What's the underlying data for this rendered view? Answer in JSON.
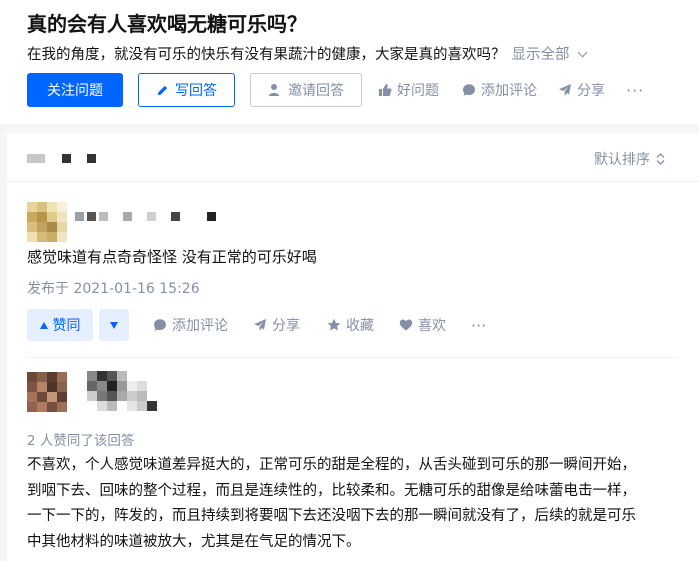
{
  "question": {
    "title": "真的会有人喜欢喝无糖可乐吗？",
    "description": "在我的角度，就没有可乐的快乐有没有果蔬汁的健康，大家是真的喜欢吗？",
    "show_all": "显示全部"
  },
  "actions": {
    "follow": "关注问题",
    "write": "写回答",
    "invite": "邀请回答",
    "good_question": "好问题",
    "add_comment": "添加评论",
    "share": "分享",
    "more": "···"
  },
  "answers_header": {
    "sort_label": "默认排序"
  },
  "answer1": {
    "content": "感觉味道有点奇奇怪怪 没有正常的可乐好喝",
    "published": "发布于 2021-01-16 15:26",
    "vote_up": "赞同",
    "add_comment": "添加评论",
    "share": "分享",
    "collect": "收藏",
    "like": "喜欢",
    "more": "···"
  },
  "answer2": {
    "likes_text": "2 人赞同了该回答",
    "lines": [
      "不喜欢，个人感觉味道差异挺大的，正常可乐的甜是全程的，从舌头碰到可乐的那一瞬间开始，",
      "到咽下去、回味的整个过程，而且是连续性的，比较柔和。无糖可乐的甜像是给味蕾电击一样，",
      "一下一下的，阵发的，而且持续到将要咽下去还没咽下去的那一瞬间就没有了，后续的就是可乐",
      "中其他材料的味道被放大，尤其是在气足的情况下。"
    ]
  },
  "colors": {
    "brand_blue": "#0066ff",
    "muted_gray": "#8590a6",
    "vote_bg": "#e5efff"
  }
}
